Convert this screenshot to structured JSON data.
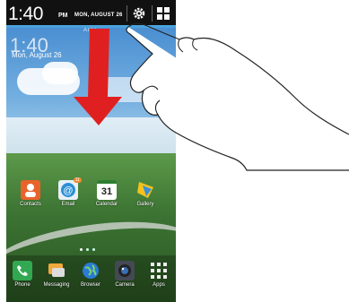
{
  "status_bar": {
    "time": "1:40",
    "ampm": "PM",
    "date": "MON, AUGUST 26",
    "settings_icon": "gear-icon",
    "quick_panel_icon": "grid-icon",
    "accent_color": "#4aa3dd"
  },
  "home": {
    "carrier": "AT&T",
    "clock": "1:40",
    "date": "Mon, August 26",
    "weather_icon": "sun-cloud-icon"
  },
  "apps": [
    {
      "label": "Contacts",
      "color": "#e8632b"
    },
    {
      "label": "Email",
      "color": "#2d8fd5",
      "badge": "11"
    },
    {
      "label": "Calendar",
      "color": "#ffffff",
      "text": "31"
    },
    {
      "label": "Gallery",
      "color": "#f6c21a"
    }
  ],
  "dock": [
    {
      "label": "Phone",
      "color": "#33a852"
    },
    {
      "label": "Messaging",
      "color": "#f2a93b"
    },
    {
      "label": "Browser",
      "color": "#2a7bd6"
    },
    {
      "label": "Camera",
      "color": "#444a55"
    },
    {
      "label": "Apps",
      "color": "#555555"
    }
  ],
  "gesture": {
    "arrow_color": "#e02020",
    "direction": "swipe-down"
  }
}
